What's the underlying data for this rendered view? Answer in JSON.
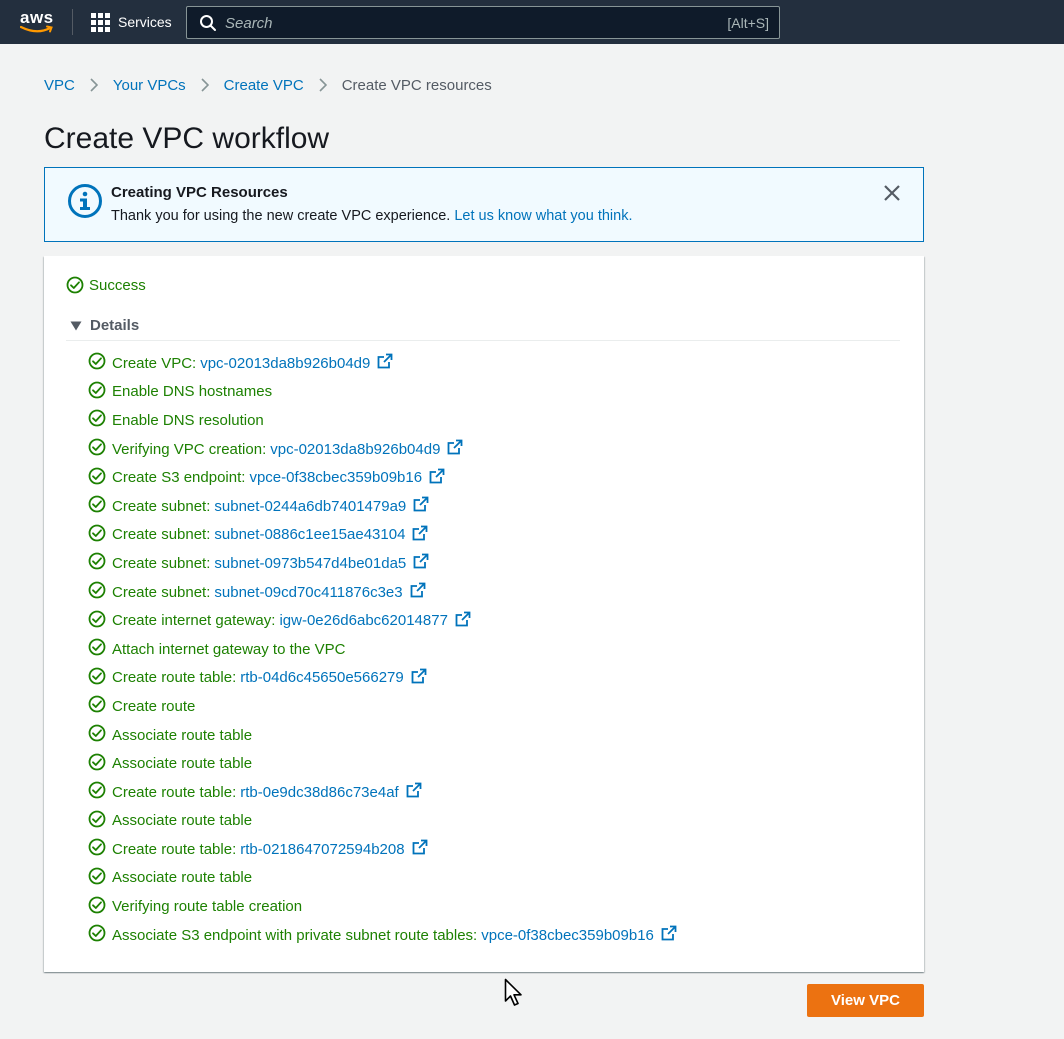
{
  "nav": {
    "logo_text": "aws",
    "services_label": "Services",
    "search_placeholder": "Search",
    "search_shortcut": "[Alt+S]"
  },
  "breadcrumb": {
    "items": [
      "VPC",
      "Your VPCs",
      "Create VPC"
    ],
    "current": "Create VPC resources"
  },
  "page_title": "Create VPC workflow",
  "flash": {
    "title": "Creating VPC Resources",
    "body": "Thank you for using the new create VPC experience.",
    "link": "Let us know what you think."
  },
  "status": "Success",
  "details_label": "Details",
  "steps": [
    {
      "label": "Create VPC:",
      "id": "vpc-02013da8b926b04d9"
    },
    {
      "label": "Enable DNS hostnames"
    },
    {
      "label": "Enable DNS resolution"
    },
    {
      "label": "Verifying VPC creation:",
      "id": "vpc-02013da8b926b04d9"
    },
    {
      "label": "Create S3 endpoint:",
      "id": "vpce-0f38cbec359b09b16"
    },
    {
      "label": "Create subnet:",
      "id": "subnet-0244a6db7401479a9"
    },
    {
      "label": "Create subnet:",
      "id": "subnet-0886c1ee15ae43104"
    },
    {
      "label": "Create subnet:",
      "id": "subnet-0973b547d4be01da5"
    },
    {
      "label": "Create subnet:",
      "id": "subnet-09cd70c411876c3e3"
    },
    {
      "label": "Create internet gateway:",
      "id": "igw-0e26d6abc62014877"
    },
    {
      "label": "Attach internet gateway to the VPC"
    },
    {
      "label": "Create route table:",
      "id": "rtb-04d6c45650e566279"
    },
    {
      "label": "Create route"
    },
    {
      "label": "Associate route table"
    },
    {
      "label": "Associate route table"
    },
    {
      "label": "Create route table:",
      "id": "rtb-0e9dc38d86c73e4af"
    },
    {
      "label": "Associate route table"
    },
    {
      "label": "Create route table:",
      "id": "rtb-0218647072594b208"
    },
    {
      "label": "Associate route table"
    },
    {
      "label": "Verifying route table creation"
    },
    {
      "label": "Associate S3 endpoint with private subnet route tables:",
      "id": "vpce-0f38cbec359b09b16"
    }
  ],
  "view_button": "View VPC",
  "colors": {
    "nav_bg": "#232f3e",
    "link": "#0073bb",
    "success": "#1d8102",
    "primary_button": "#ec7211",
    "info_bg": "#f1faff"
  }
}
